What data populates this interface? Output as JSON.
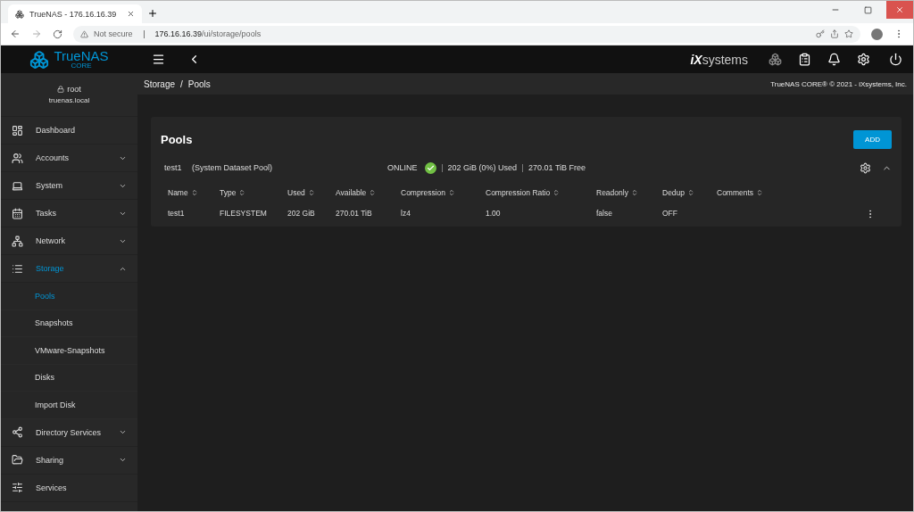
{
  "browser": {
    "tab_title": "TrueNAS - 176.16.16.39",
    "security": "Not secure",
    "url_host": "176.16.16.39",
    "url_path": "/ui/storage/pools"
  },
  "header": {
    "logo": "TrueNAS",
    "logo_sub": "CORE",
    "partner_mark": "iX",
    "partner_word": "systems"
  },
  "user": {
    "name": "root",
    "host": "truenas.local"
  },
  "breadcrumb": [
    "Storage",
    "Pools"
  ],
  "breadcrumb_separator": "/",
  "copyright": "TrueNAS CORE® © 2021 - iXsystems, Inc.",
  "sidebar": [
    {
      "label": "Dashboard",
      "expandable": false,
      "expanded": false,
      "selected": false
    },
    {
      "label": "Accounts",
      "expandable": true,
      "expanded": false,
      "selected": false
    },
    {
      "label": "System",
      "expandable": true,
      "expanded": false,
      "selected": false
    },
    {
      "label": "Tasks",
      "expandable": true,
      "expanded": false,
      "selected": false
    },
    {
      "label": "Network",
      "expandable": true,
      "expanded": false,
      "selected": false
    },
    {
      "label": "Storage",
      "expandable": true,
      "expanded": true,
      "selected": true,
      "children": [
        {
          "label": "Pools",
          "selected": true
        },
        {
          "label": "Snapshots",
          "selected": false
        },
        {
          "label": "VMware-Snapshots",
          "selected": false
        },
        {
          "label": "Disks",
          "selected": false
        },
        {
          "label": "Import Disk",
          "selected": false
        }
      ]
    },
    {
      "label": "Directory Services",
      "expandable": true,
      "expanded": false,
      "selected": false
    },
    {
      "label": "Sharing",
      "expandable": true,
      "expanded": false,
      "selected": false
    },
    {
      "label": "Services",
      "expandable": false,
      "expanded": false,
      "selected": false
    }
  ],
  "page": {
    "title": "Pools",
    "add_button": "ADD"
  },
  "pool": {
    "name": "test1",
    "note": "(System Dataset Pool)",
    "status": "ONLINE",
    "healthy": true,
    "used": "202 GiB (0%) Used",
    "free": "270.01 TiB Free",
    "expanded": true,
    "columns": [
      "Name",
      "Type",
      "Used",
      "Available",
      "Compression",
      "Compression Ratio",
      "Readonly",
      "Dedup",
      "Comments"
    ],
    "rows": [
      [
        "test1",
        "FILESYSTEM",
        "202 GiB",
        "270.01 TiB",
        "lz4",
        "1.00",
        "false",
        "OFF",
        null
      ]
    ]
  }
}
